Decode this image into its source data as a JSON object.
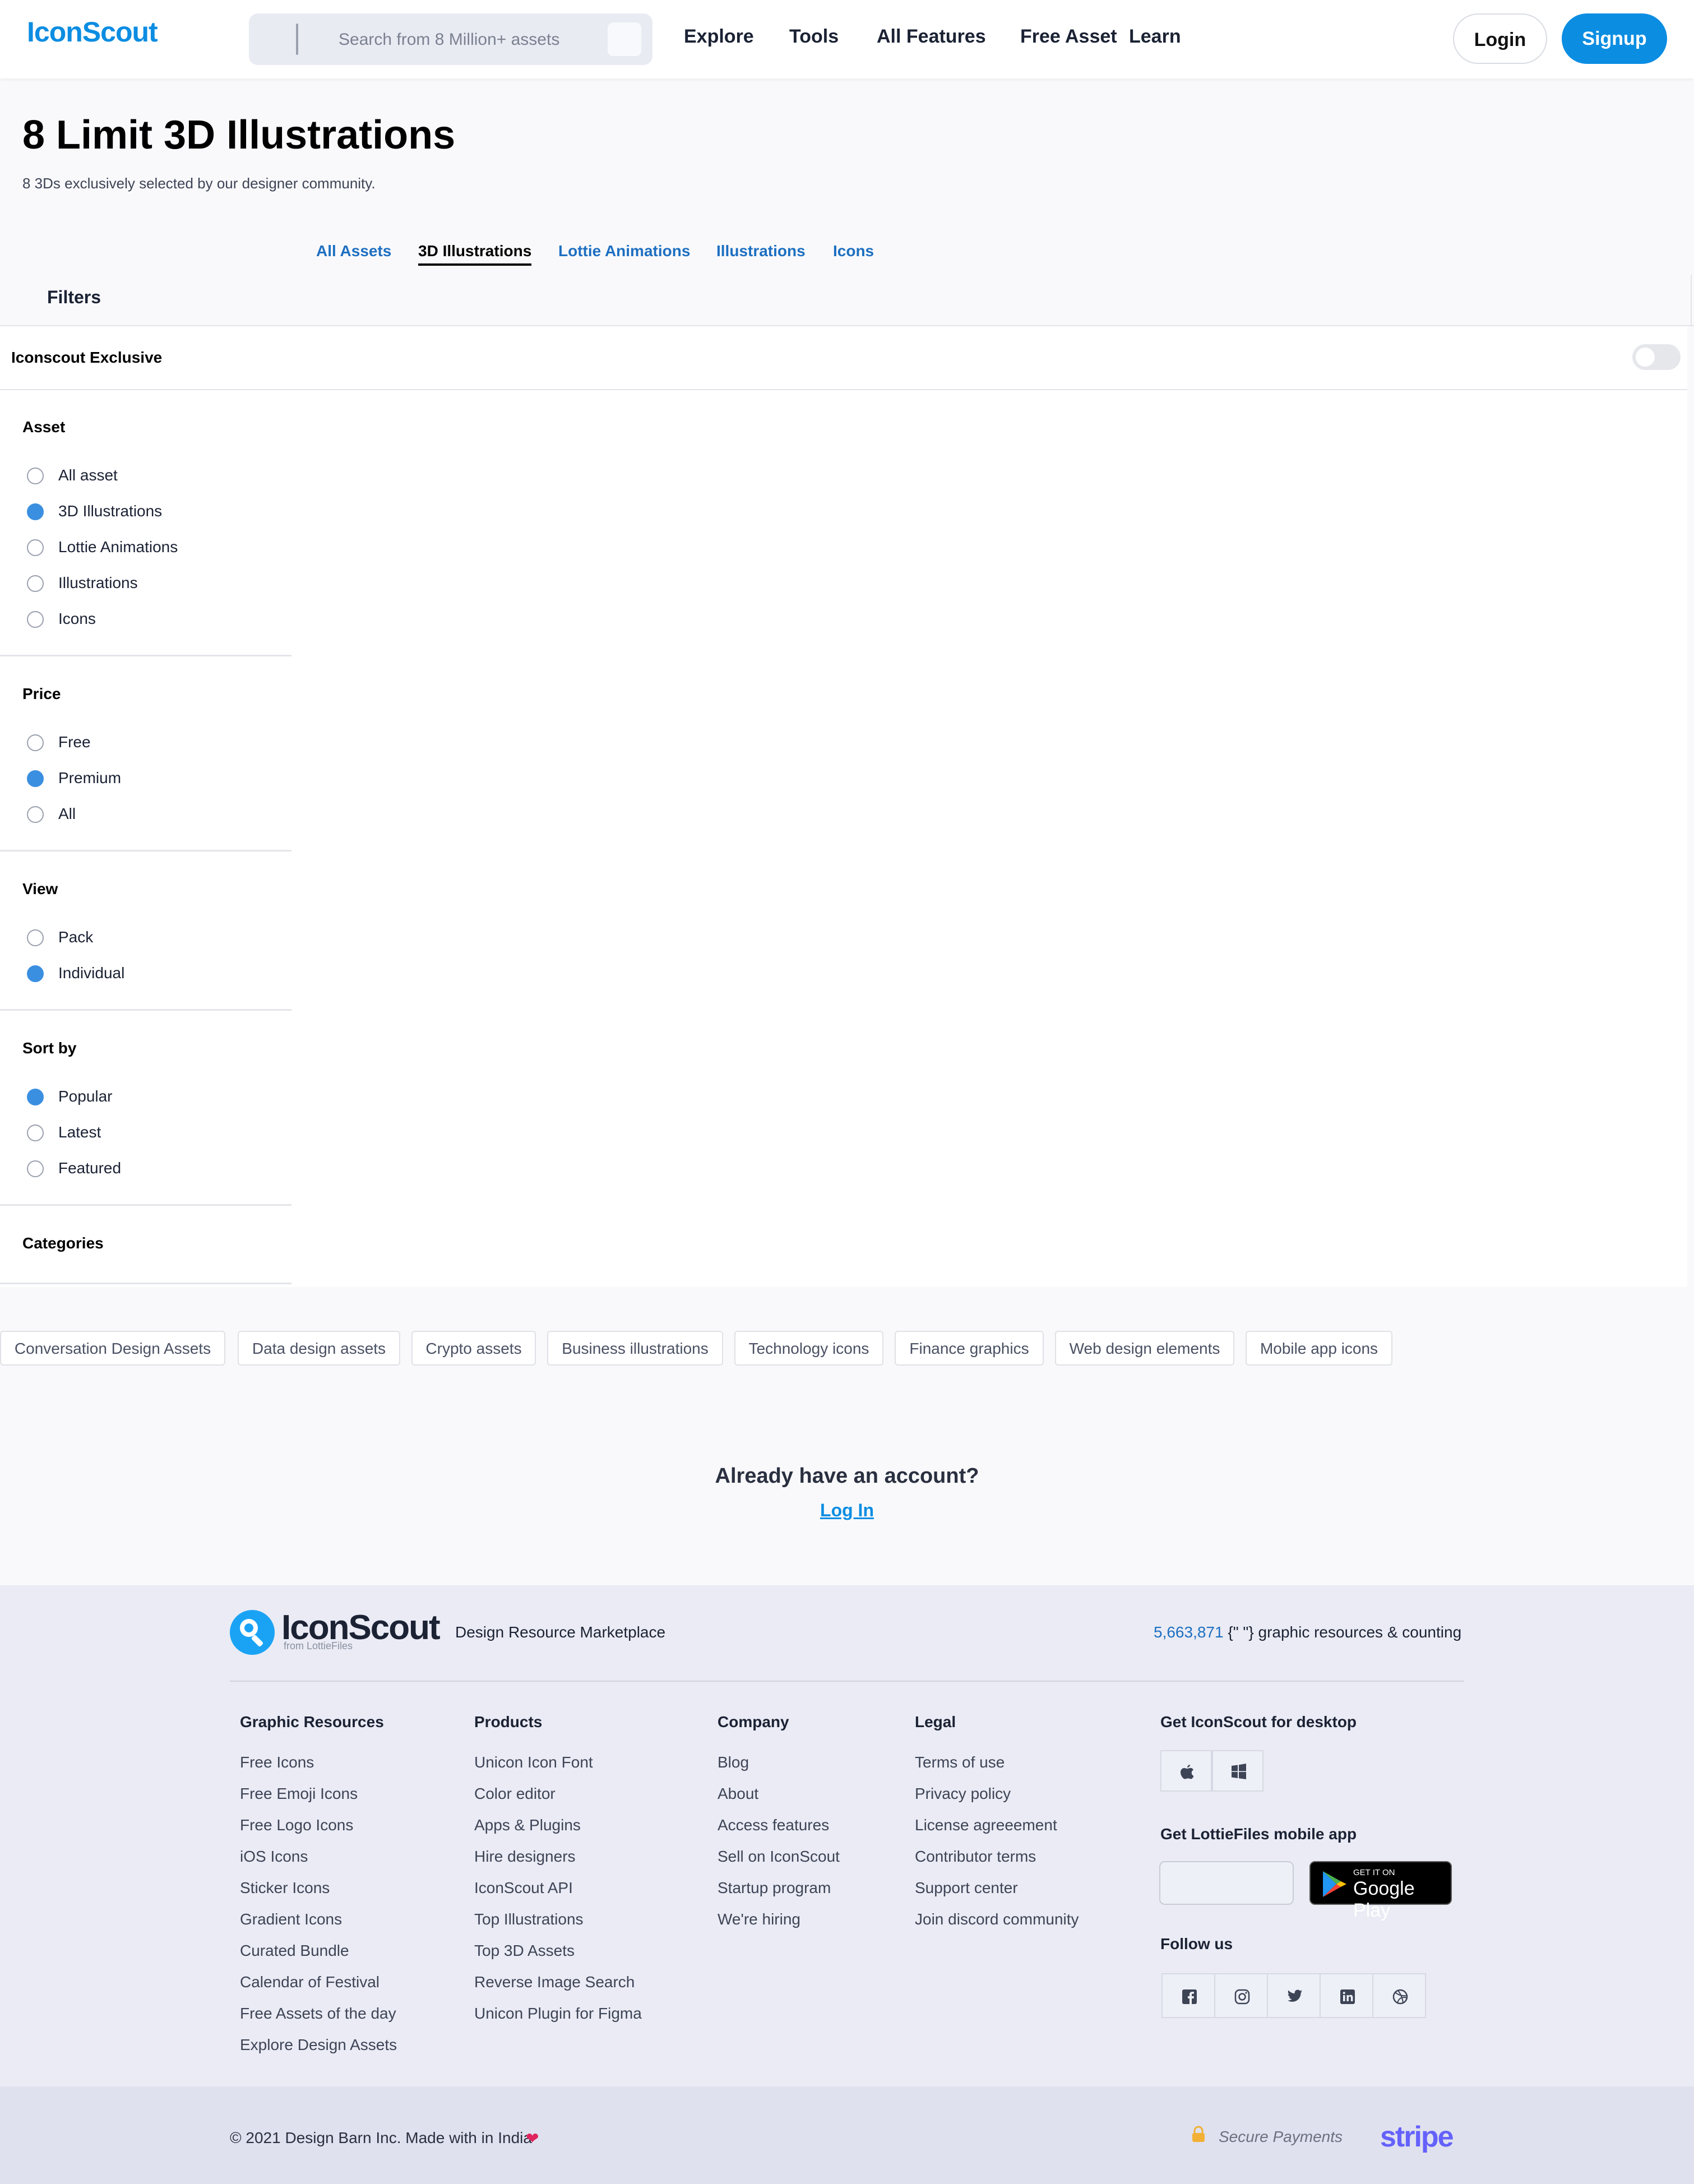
{
  "header": {
    "logo": "IconScout",
    "search_placeholder": "Search from 8 Million+ assets",
    "nav": [
      "Explore",
      "Tools",
      "All Features",
      "Free Asset",
      "Learn"
    ],
    "login_label": "Login",
    "signup_label": "Signup"
  },
  "page": {
    "title": "8 Limit 3D Illustrations",
    "subtitle": "8 3Ds exclusively selected by our designer community."
  },
  "tabs": [
    {
      "label": "All Assets",
      "active": false
    },
    {
      "label": "3D Illustrations",
      "active": true
    },
    {
      "label": "Lottie Animations",
      "active": false
    },
    {
      "label": "Illustrations",
      "active": false
    },
    {
      "label": "Icons",
      "active": false
    }
  ],
  "filters": {
    "title": "Filters",
    "exclusive_label": "Iconscout Exclusive",
    "exclusive_on": false,
    "asset": {
      "title": "Asset",
      "options": [
        "All asset",
        "3D Illustrations",
        "Lottie Animations",
        "Illustrations",
        "Icons"
      ],
      "selected": "3D Illustrations"
    },
    "price": {
      "title": "Price",
      "options": [
        "Free",
        "Premium",
        "All"
      ],
      "selected": "Premium"
    },
    "view": {
      "title": "View",
      "options": [
        "Pack",
        "Individual"
      ],
      "selected": "Individual"
    },
    "sort": {
      "title": "Sort by",
      "options": [
        "Popular",
        "Latest",
        "Featured"
      ],
      "selected": "Popular"
    },
    "categories_title": "Categories"
  },
  "tags": [
    "Conversation Design Assets",
    "Data design assets",
    "Crypto assets",
    "Business illustrations",
    "Technology icons",
    "Finance graphics",
    "Web design elements",
    "Mobile app icons"
  ],
  "account": {
    "question": "Already have an account?",
    "link": "Log In"
  },
  "footer": {
    "logo": "IconScout",
    "logo_sub": "from LottieFiles",
    "tagline": "Design Resource Marketplace",
    "count_number": "5,663,871",
    "count_text": " {\" \"} graphic resources & counting",
    "columns": [
      {
        "title": "Graphic Resources",
        "links": [
          "Free Icons",
          "Free Emoji Icons",
          "Free Logo Icons",
          "iOS Icons",
          "Sticker Icons",
          "Gradient Icons",
          "Curated Bundle",
          "Calendar of Festival",
          "Free Assets of the day",
          "Explore Design Assets"
        ]
      },
      {
        "title": "Products",
        "links": [
          "Unicon Icon Font",
          "Color editor",
          "Apps & Plugins",
          "Hire designers",
          "IconScout API",
          "Top Illustrations",
          "Top 3D Assets",
          "Reverse Image Search",
          "Unicon Plugin for Figma"
        ]
      },
      {
        "title": "Company",
        "links": [
          "Blog",
          "About",
          "Access features",
          "Sell on IconScout",
          "Startup program",
          "We're hiring"
        ]
      },
      {
        "title": "Legal",
        "links": [
          "Terms of use",
          "Privacy policy",
          "License agreeement",
          "Contributor terms",
          "Support center",
          "Join discord community"
        ]
      }
    ],
    "desktop_title": "Get IconScout for desktop",
    "mobile_title": "Get LottieFiles mobile app",
    "gplay_small": "GET IT ON",
    "gplay_big": "Google Play",
    "follow_title": "Follow us",
    "copyright": "© 2021 Design Barn Inc. Made with in India",
    "secure": "Secure Payments",
    "stripe": "stripe"
  }
}
